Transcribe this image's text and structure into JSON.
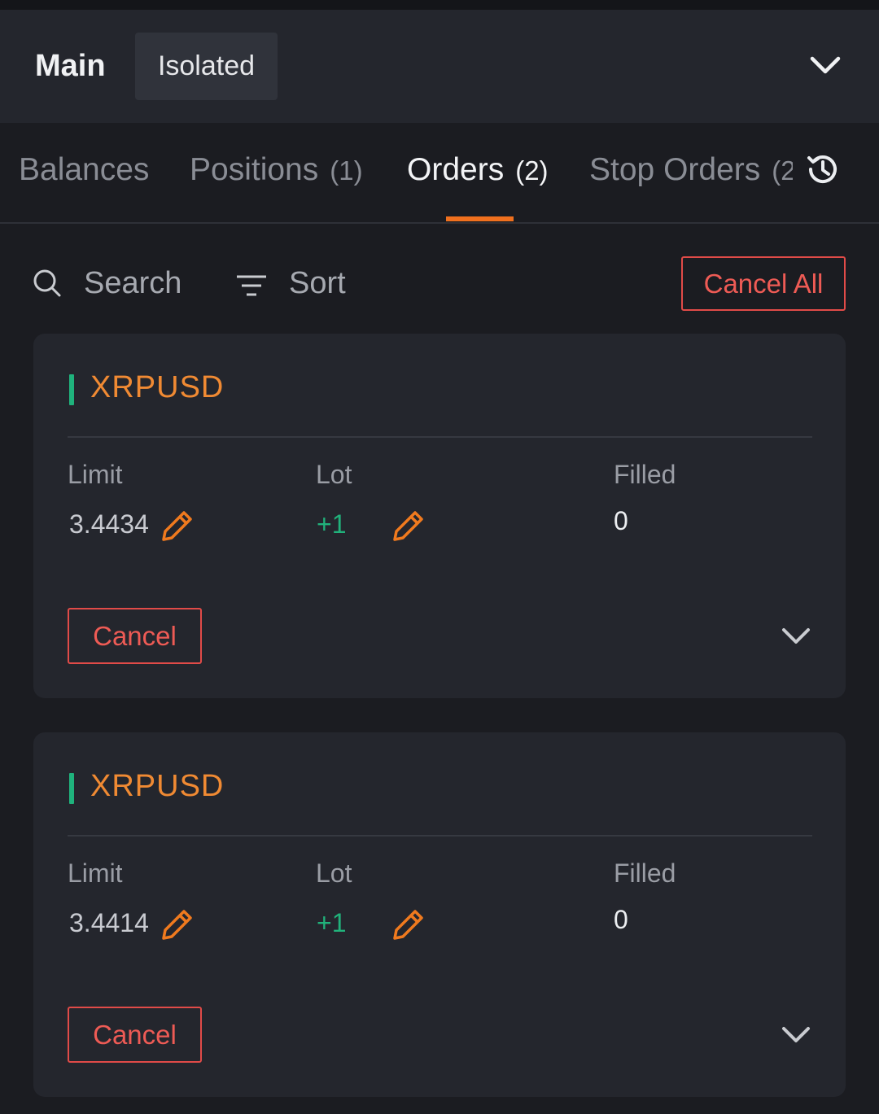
{
  "header": {
    "account_main": "Main",
    "account_mode": "Isolated"
  },
  "tabs": [
    {
      "label": "Balances",
      "count": ""
    },
    {
      "label": "Positions",
      "count": "(1)"
    },
    {
      "label": "Orders",
      "count": "(2)"
    },
    {
      "label": "Stop Orders",
      "count": "(2"
    }
  ],
  "active_tab": "Orders",
  "toolbar": {
    "search_label": "Search",
    "sort_label": "Sort",
    "cancel_all_label": "Cancel All"
  },
  "orders": [
    {
      "symbol": "XRPUSD",
      "limit_label": "Limit",
      "limit_value": "3.4434",
      "lot_label": "Lot",
      "lot_value": "+1",
      "filled_label": "Filled",
      "filled_value": "0",
      "cancel_label": "Cancel"
    },
    {
      "symbol": "XRPUSD",
      "limit_label": "Limit",
      "limit_value": "3.4414",
      "lot_label": "Lot",
      "lot_value": "+1",
      "filled_label": "Filled",
      "filled_value": "0",
      "cancel_label": "Cancel"
    }
  ],
  "colors": {
    "accent": "#f0701e",
    "symbol": "#f08a33",
    "buy": "#21b27b",
    "danger": "#ee5b55",
    "background": "#1b1c21",
    "card": "#24262d"
  },
  "icons": [
    "chevron-down-icon",
    "history-icon",
    "search-icon",
    "sort-icon",
    "pencil-icon"
  ]
}
